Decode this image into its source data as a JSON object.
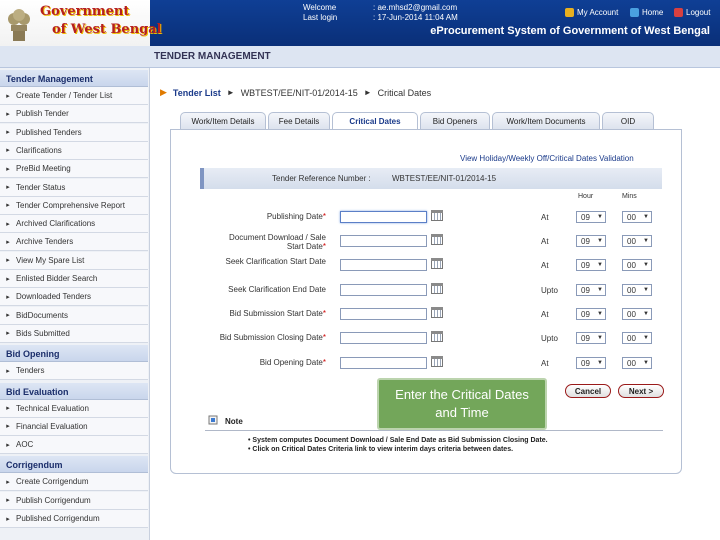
{
  "header": {
    "gov_line1": "Government",
    "gov_line2": "of West Bengal",
    "welcome_label": "Welcome",
    "welcome_value": ": ae.mhsd2@gmail.com",
    "last_login_label": "Last login",
    "last_login_value": ": 17-Jun-2014 11:04 AM",
    "my_account": "My Account",
    "home": "Home",
    "logout": "Logout",
    "portal_title": "eProcurement System of Government of West Bengal",
    "section_title": "TENDER MANAGEMENT"
  },
  "sidebar": {
    "sections": [
      {
        "title": "Tender Management",
        "items": [
          "Create Tender / Tender List",
          "Publish Tender",
          "Published Tenders",
          "Clarifications",
          "PreBid Meeting",
          "Tender Status",
          "Tender Comprehensive Report",
          "Archived Clarifications",
          "Archive Tenders",
          "View My Spare List",
          "Enlisted Bidder Search",
          "Downloaded Tenders",
          "BidDocuments",
          "Bids Submitted"
        ]
      },
      {
        "title": "Bid Opening",
        "items": [
          "Tenders"
        ]
      },
      {
        "title": "Bid Evaluation",
        "items": [
          "Technical Evaluation",
          "Financial Evaluation",
          "AOC"
        ]
      },
      {
        "title": "Corrigendum",
        "items": [
          "Create Corrigendum",
          "Publish Corrigendum",
          "Published Corrigendum"
        ]
      }
    ]
  },
  "breadcrumb": {
    "tender_list": "Tender List",
    "ref": "WBTEST/EE/NIT-01/2014-15",
    "current": "Critical Dates"
  },
  "tabs": [
    "Work/Item Details",
    "Fee Details",
    "Critical Dates",
    "Bid Openers",
    "Work/Item Documents",
    "OID"
  ],
  "active_tab": "Critical Dates",
  "form": {
    "validation_link": "View Holiday/Weekly Off/Critical Dates Validation",
    "ref_label": "Tender Reference Number :",
    "ref_value": "WBTEST/EE/NIT-01/2014-15",
    "hour_header": "Hour",
    "mins_header": "Mins",
    "rows": [
      {
        "label": "Publishing Date",
        "required": true,
        "at": "At",
        "hour": "09",
        "mins": "00"
      },
      {
        "label": "Document Download / Sale Start Date",
        "required": true,
        "at": "At",
        "hour": "09",
        "mins": "00"
      },
      {
        "label": "Seek Clarification Start Date",
        "required": false,
        "at": "At",
        "hour": "09",
        "mins": "00"
      },
      {
        "label": "Seek Clarification End Date",
        "required": false,
        "at": "Upto",
        "hour": "09",
        "mins": "00"
      },
      {
        "label": "Bid Submission Start Date",
        "required": true,
        "at": "At",
        "hour": "09",
        "mins": "00"
      },
      {
        "label": "Bid Submission Closing Date",
        "required": true,
        "at": "Upto",
        "hour": "09",
        "mins": "00"
      },
      {
        "label": "Bid Opening Date",
        "required": true,
        "at": "At",
        "hour": "09",
        "mins": "00"
      }
    ],
    "cancel": "Cancel",
    "next": "Next >"
  },
  "note": {
    "title": "Note",
    "lines": [
      "System computes Document Download / Sale End Date as Bid Submission Closing Date.",
      "Click on Critical Dates Criteria link to view interim days criteria between dates."
    ]
  },
  "callout": "Enter the Critical Dates and Time"
}
